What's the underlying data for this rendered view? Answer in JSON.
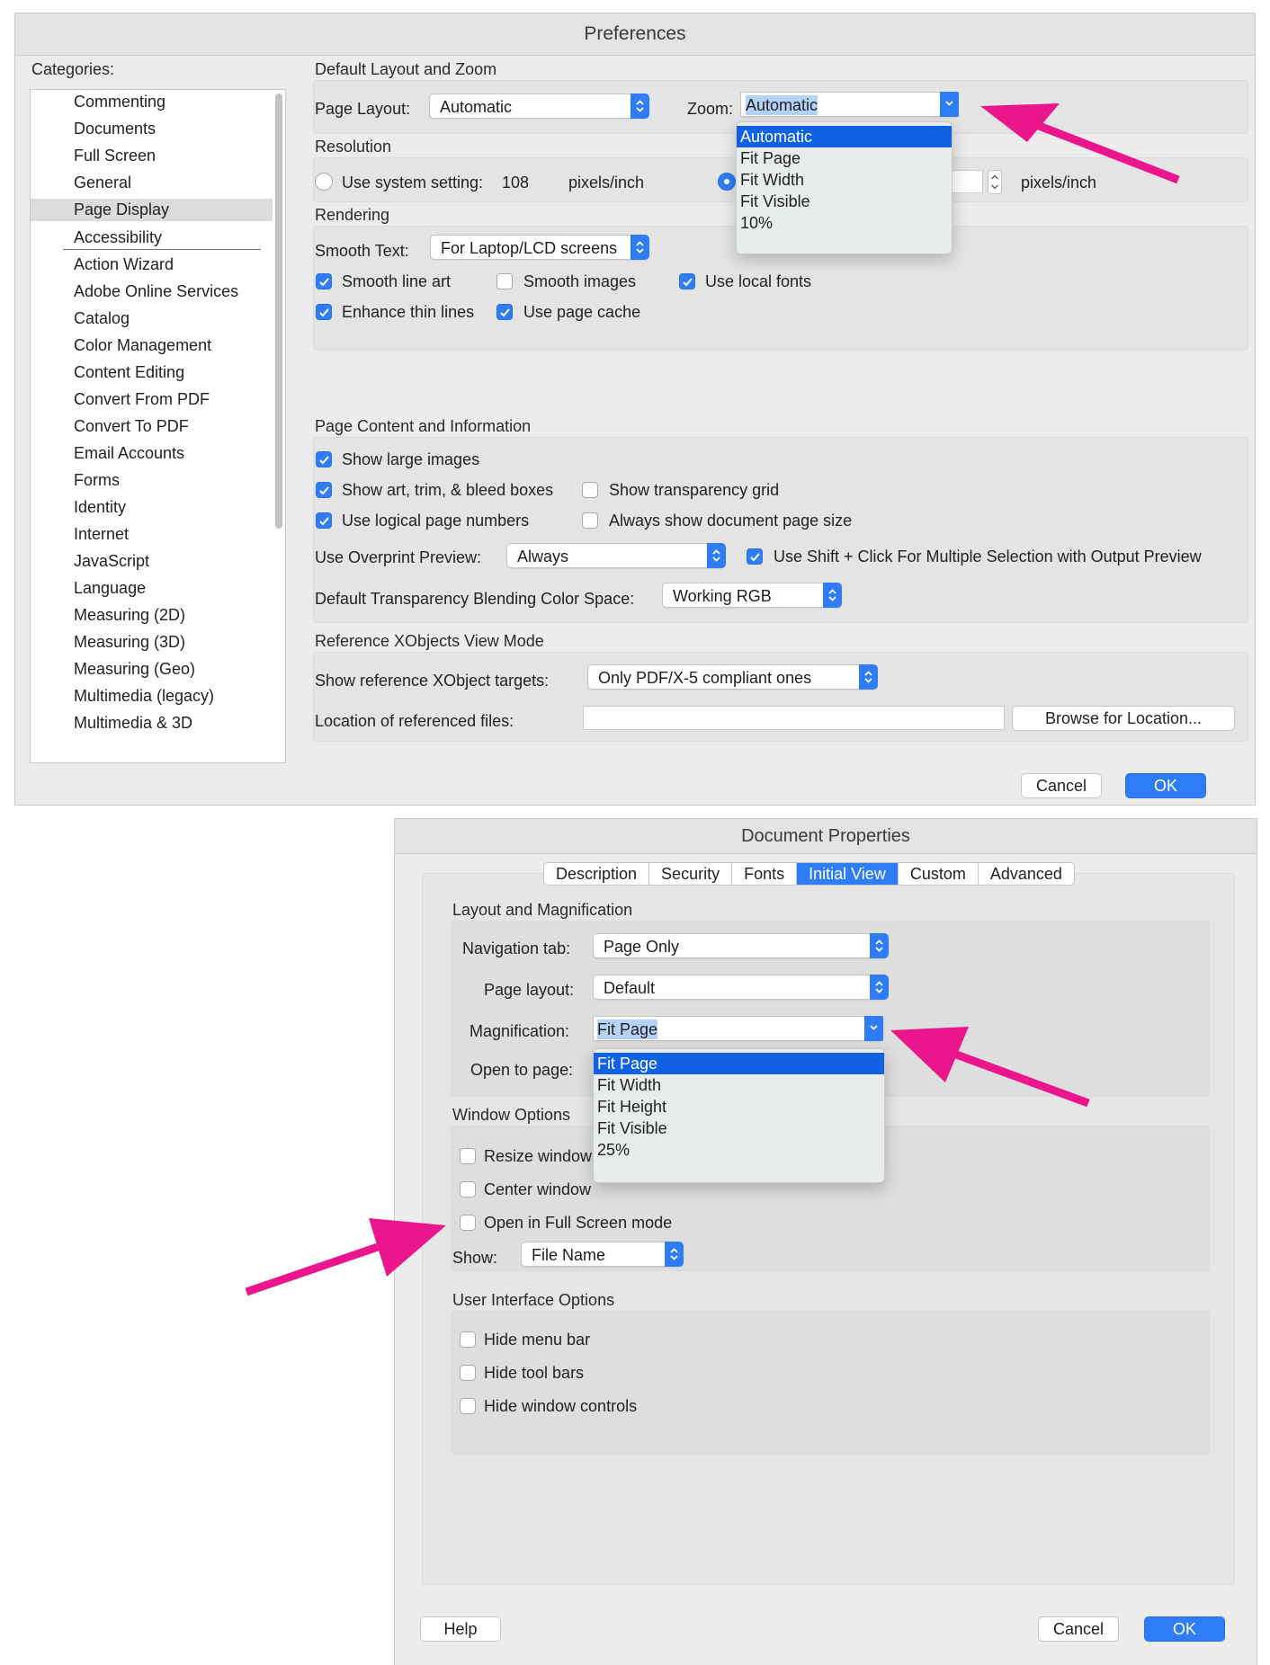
{
  "preferences": {
    "title": "Preferences",
    "categories_label": "Categories:",
    "top_categories": [
      "Commenting",
      "Documents",
      "Full Screen",
      "General",
      "Page Display"
    ],
    "selected_category": "Page Display",
    "categories": [
      "Accessibility",
      "Action Wizard",
      "Adobe Online Services",
      "Catalog",
      "Color Management",
      "Content Editing",
      "Convert From PDF",
      "Convert To PDF",
      "Email Accounts",
      "Forms",
      "Identity",
      "Internet",
      "JavaScript",
      "Language",
      "Measuring (2D)",
      "Measuring (3D)",
      "Measuring (Geo)",
      "Multimedia (legacy)",
      "Multimedia & 3D"
    ],
    "layout_zoom": {
      "section": "Default Layout and Zoom",
      "page_layout_label": "Page Layout:",
      "page_layout_value": "Automatic",
      "zoom_label": "Zoom:",
      "zoom_value": "Automatic",
      "zoom_options": [
        "Automatic",
        "Fit Page",
        "Fit Width",
        "Fit Visible",
        "10%"
      ]
    },
    "resolution": {
      "section": "Resolution",
      "system_label": "Use system setting:",
      "system_value": "108",
      "unit": "pixels/inch",
      "custom_unit": "pixels/inch"
    },
    "rendering": {
      "section": "Rendering",
      "smooth_text_label": "Smooth Text:",
      "smooth_text_value": "For Laptop/LCD screens",
      "smooth_line_art": "Smooth line art",
      "smooth_images": "Smooth images",
      "use_local_fonts": "Use local fonts",
      "enhance_thin_lines": "Enhance thin lines",
      "use_page_cache": "Use page cache"
    },
    "page_content": {
      "section": "Page Content and Information",
      "show_large_images": "Show large images",
      "show_art_boxes": "Show art, trim, & bleed boxes",
      "show_transparency_grid": "Show transparency grid",
      "use_logical_page_numbers": "Use logical page numbers",
      "always_show_page_size": "Always show document page size",
      "overprint_label": "Use Overprint Preview:",
      "overprint_value": "Always",
      "shift_click": "Use Shift + Click For Multiple Selection with Output Preview",
      "blending_label": "Default Transparency Blending Color Space:",
      "blending_value": "Working RGB"
    },
    "xobjects": {
      "section": "Reference XObjects View Mode",
      "targets_label": "Show reference XObject targets:",
      "targets_value": "Only PDF/X-5 compliant ones",
      "location_label": "Location of referenced files:",
      "location_value": "",
      "browse_button": "Browse for Location..."
    },
    "cancel_button": "Cancel",
    "ok_button": "OK"
  },
  "document_properties": {
    "title": "Document Properties",
    "tabs": [
      "Description",
      "Security",
      "Fonts",
      "Initial View",
      "Custom",
      "Advanced"
    ],
    "active_tab": "Initial View",
    "layout_magnification": {
      "section": "Layout and Magnification",
      "navigation_label": "Navigation tab:",
      "navigation_value": "Page Only",
      "page_layout_label": "Page layout:",
      "page_layout_value": "Default",
      "magnification_label": "Magnification:",
      "magnification_value": "Fit Page",
      "magnification_options": [
        "Fit Page",
        "Fit Width",
        "Fit Height",
        "Fit Visible",
        "25%"
      ],
      "open_to_page_label": "Open to page:"
    },
    "window_options": {
      "section": "Window Options",
      "resize_window": "Resize window",
      "center_window": "Center window",
      "full_screen": "Open in Full Screen mode",
      "show_label": "Show:",
      "show_value": "File Name"
    },
    "ui_options": {
      "section": "User Interface Options",
      "hide_menu_bar": "Hide menu bar",
      "hide_tool_bars": "Hide tool bars",
      "hide_window_controls": "Hide window controls"
    },
    "help_button": "Help",
    "cancel_button": "Cancel",
    "ok_button": "OK"
  },
  "colors": {
    "accent": "#2f7df6",
    "menu_selection": "#1162e3",
    "annotation_arrow": "#ec168c"
  }
}
